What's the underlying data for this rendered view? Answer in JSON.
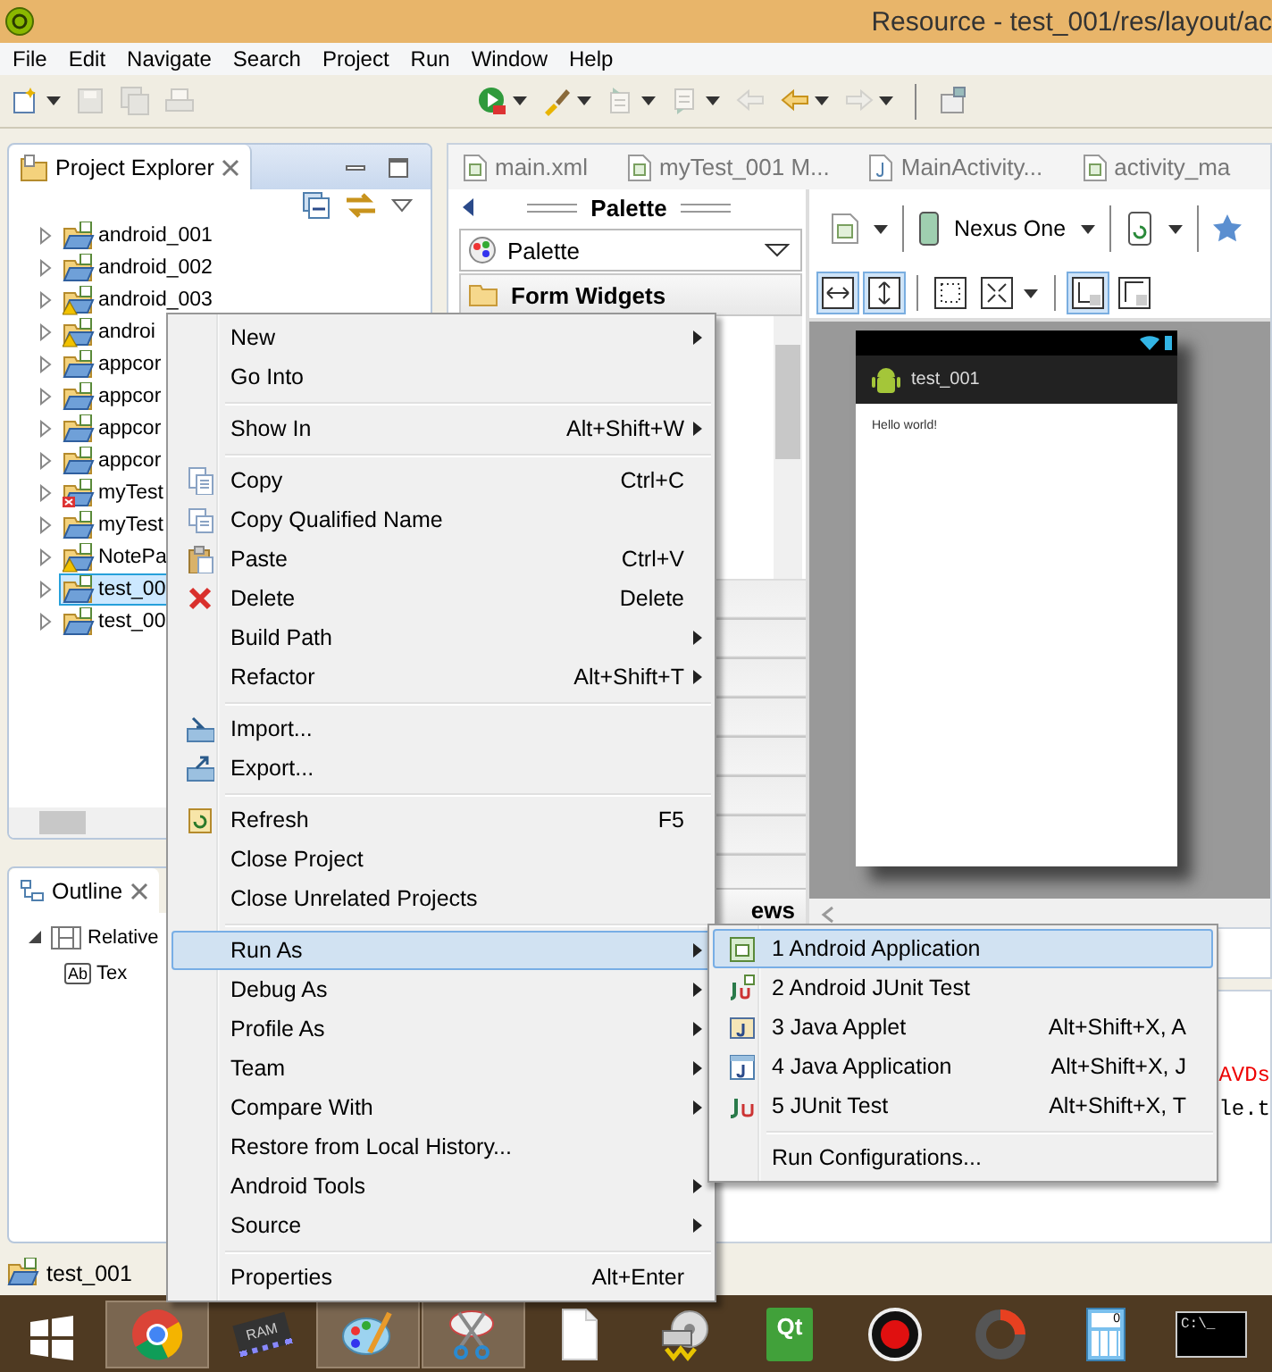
{
  "window": {
    "title": "Resource - test_001/res/layout/ac"
  },
  "menu_bar": [
    "File",
    "Edit",
    "Navigate",
    "Search",
    "Project",
    "Run",
    "Window",
    "Help"
  ],
  "toolbar": {
    "left": [
      {
        "kind": "new-file",
        "dropdown": true,
        "disabled": false
      },
      {
        "kind": "save",
        "dropdown": false,
        "disabled": true
      },
      {
        "kind": "save-all",
        "dropdown": false,
        "disabled": true
      },
      {
        "kind": "print",
        "dropdown": false,
        "disabled": true
      }
    ],
    "right": [
      {
        "kind": "run",
        "dropdown": true,
        "disabled": false
      },
      {
        "kind": "brush",
        "dropdown": true,
        "disabled": false
      },
      {
        "kind": "next",
        "dropdown": true,
        "disabled": true
      },
      {
        "kind": "prev",
        "dropdown": true,
        "disabled": true
      },
      {
        "kind": "back-edit",
        "dropdown": false,
        "disabled": true
      },
      {
        "kind": "back",
        "dropdown": true,
        "disabled": false
      },
      {
        "kind": "forward",
        "dropdown": true,
        "disabled": true
      },
      {
        "kind": "separator"
      },
      {
        "kind": "pin",
        "dropdown": false,
        "disabled": false
      }
    ]
  },
  "project_explorer": {
    "title": "Project Explorer",
    "items": [
      {
        "label": "android_001",
        "expanded": false,
        "selected": false
      },
      {
        "label": "android_002",
        "expanded": false,
        "selected": false
      },
      {
        "label": "android_003",
        "expanded": false,
        "selected": false,
        "kind": "warning"
      },
      {
        "label": "androi",
        "expanded": false,
        "selected": false,
        "kind": "warning"
      },
      {
        "label": "appcor",
        "expanded": false,
        "selected": false
      },
      {
        "label": "appcor",
        "expanded": false,
        "selected": false
      },
      {
        "label": "appcor",
        "expanded": false,
        "selected": false
      },
      {
        "label": "appcor",
        "expanded": false,
        "selected": false
      },
      {
        "label": "myTest",
        "expanded": false,
        "selected": false,
        "kind": "error"
      },
      {
        "label": "myTest",
        "expanded": false,
        "selected": false
      },
      {
        "label": "NotePa",
        "expanded": false,
        "selected": false,
        "kind": "warning"
      },
      {
        "label": "test_00",
        "expanded": false,
        "selected": true
      },
      {
        "label": "test_00",
        "expanded": false,
        "selected": false
      }
    ]
  },
  "outline": {
    "title": "Outline",
    "items": [
      {
        "label": "Relative",
        "kind": "layout",
        "expanded": true,
        "children": [
          {
            "label": "Tex",
            "kind": "text",
            "badge": "Ab"
          }
        ]
      }
    ]
  },
  "editor_tabs": [
    {
      "label": "main.xml",
      "kind": "xml"
    },
    {
      "label": "myTest_001 M...",
      "kind": "xml"
    },
    {
      "label": "MainActivity...",
      "kind": "java"
    },
    {
      "label": "activity_ma",
      "kind": "xml"
    }
  ],
  "palette": {
    "title": "Palette",
    "dropdown": "Palette",
    "section": "Form Widgets",
    "categories": [
      {
        "label": "ews"
      }
    ]
  },
  "layout_editor": {
    "device": "Nexus One",
    "view_buttons": [
      {
        "kind": "fit-width",
        "selected": true
      },
      {
        "kind": "fit-height",
        "selected": true
      },
      {
        "kind": "margins",
        "selected": false
      },
      {
        "kind": "resize",
        "selected": false,
        "dropdown": true
      },
      {
        "kind": "layout-top",
        "selected": true
      },
      {
        "kind": "layout-bottom",
        "selected": false
      }
    ],
    "app_title": "test_001",
    "content_text": "Hello world!"
  },
  "console": {
    "lines": [
      {
        "text": "AVDs",
        "kind": "error"
      },
      {
        "text": "le.t",
        "kind": "plain"
      }
    ]
  },
  "status_bar": {
    "label": "test_001"
  },
  "context_menu": {
    "groups": [
      [
        {
          "label": "New",
          "submenu": true,
          "selected": false
        },
        {
          "label": "Go Into",
          "selected": false
        }
      ],
      [
        {
          "label": "Show In",
          "shortcut": "Alt+Shift+W",
          "submenu": true,
          "selected": false
        }
      ],
      [
        {
          "label": "Copy",
          "shortcut": "Ctrl+C",
          "kind": "copy",
          "selected": false
        },
        {
          "label": "Copy Qualified Name",
          "kind": "copy2",
          "selected": false
        },
        {
          "label": "Paste",
          "shortcut": "Ctrl+V",
          "kind": "paste",
          "selected": false
        },
        {
          "label": "Delete",
          "shortcut": "Delete",
          "kind": "delete",
          "selected": false
        },
        {
          "label": "Build Path",
          "submenu": true,
          "selected": false
        },
        {
          "label": "Refactor",
          "shortcut": "Alt+Shift+T",
          "submenu": true,
          "selected": false
        }
      ],
      [
        {
          "label": "Import...",
          "kind": "import",
          "selected": false
        },
        {
          "label": "Export...",
          "kind": "export",
          "selected": false
        }
      ],
      [
        {
          "label": "Refresh",
          "shortcut": "F5",
          "kind": "refresh",
          "selected": false
        },
        {
          "label": "Close Project",
          "selected": false
        },
        {
          "label": "Close Unrelated Projects",
          "selected": false
        }
      ],
      [
        {
          "label": "Run As",
          "submenu": true,
          "selected": true
        },
        {
          "label": "Debug As",
          "submenu": true,
          "selected": false
        },
        {
          "label": "Profile As",
          "submenu": true,
          "selected": false
        },
        {
          "label": "Team",
          "submenu": true,
          "selected": false
        },
        {
          "label": "Compare With",
          "submenu": true,
          "selected": false
        },
        {
          "label": "Restore from Local History...",
          "selected": false
        },
        {
          "label": "Android Tools",
          "submenu": true,
          "selected": false
        },
        {
          "label": "Source",
          "submenu": true,
          "selected": false
        }
      ],
      [
        {
          "label": "Properties",
          "shortcut": "Alt+Enter",
          "selected": false
        }
      ]
    ]
  },
  "run_as_menu": {
    "groups": [
      [
        {
          "label": "1 Android Application",
          "kind": "android-app",
          "selected": true
        },
        {
          "label": "2 Android JUnit Test",
          "kind": "android-junit",
          "selected": false
        },
        {
          "label": "3 Java Applet",
          "shortcut": "Alt+Shift+X, A",
          "kind": "applet",
          "selected": false
        },
        {
          "label": "4 Java Application",
          "shortcut": "Alt+Shift+X, J",
          "kind": "java-app",
          "selected": false
        },
        {
          "label": "5 JUnit Test",
          "shortcut": "Alt+Shift+X, T",
          "kind": "junit",
          "selected": false
        }
      ],
      [
        {
          "label": "Run Configurations...",
          "selected": false
        }
      ]
    ]
  },
  "taskbar": [
    {
      "kind": "start",
      "running": false
    },
    {
      "kind": "browser",
      "running": true
    },
    {
      "kind": "chip",
      "label": "RAM",
      "running": false
    },
    {
      "kind": "palette",
      "running": true
    },
    {
      "kind": "scissors",
      "running": true
    },
    {
      "kind": "document",
      "running": false
    },
    {
      "kind": "disc",
      "running": false
    },
    {
      "kind": "qt",
      "label": "Qt",
      "running": false
    },
    {
      "kind": "record",
      "running": false
    },
    {
      "kind": "ring",
      "running": false
    },
    {
      "kind": "calculator",
      "label": "0",
      "running": false
    },
    {
      "kind": "terminal",
      "label": "C:\\_",
      "running": false
    }
  ]
}
